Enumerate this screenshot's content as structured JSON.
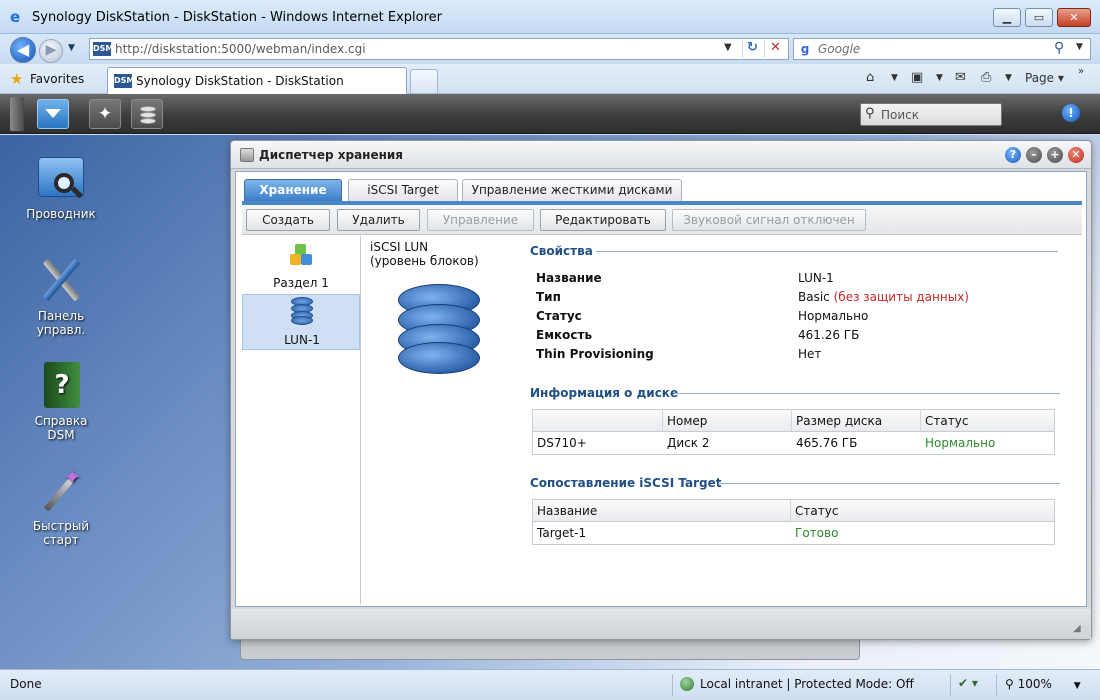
{
  "browser": {
    "window_title": "Synology DiskStation - DiskStation - Windows Internet Explorer",
    "url": "http://diskstation:5000/webman/index.cgi",
    "search_placeholder": "Google",
    "favorites_label": "Favorites",
    "tab_title": "Synology DiskStation - DiskStation",
    "page_menu": "Page",
    "favicon_text": "DSM"
  },
  "dsm_taskbar": {
    "search_placeholder": "Поиск"
  },
  "desktop_icons": [
    {
      "label": "Проводник"
    },
    {
      "label": "Панель управл."
    },
    {
      "label": "Справка DSM"
    },
    {
      "label": "Быстрый старт"
    }
  ],
  "storage_window": {
    "title": "Диспетчер хранения",
    "tabs": [
      "Хранение",
      "iSCSI Target",
      "Управление жесткими дисками"
    ],
    "toolbar": {
      "create": "Создать",
      "delete": "Удалить",
      "manage": "Управление",
      "edit": "Редактировать",
      "beep": "Звуковой сигнал отключен"
    },
    "volumes": [
      {
        "label": "Раздел 1"
      },
      {
        "label": "LUN-1"
      }
    ],
    "lun_header_line1": "iSCSI LUN",
    "lun_header_line2": "(уровень блоков)",
    "properties": {
      "section": "Свойства",
      "rows": [
        {
          "key": "Название",
          "value": "LUN-1"
        },
        {
          "key": "Тип",
          "value": "Basic",
          "note": "(без защиты данных)"
        },
        {
          "key": "Статус",
          "value": "Нормально"
        },
        {
          "key": "Емкость",
          "value": "461.26 ГБ"
        },
        {
          "key": "Thin Provisioning",
          "value": "Нет"
        }
      ]
    },
    "disk_info": {
      "section": "Информация о диске",
      "headers": [
        "",
        "Номер",
        "Размер диска",
        "Статус"
      ],
      "rows": [
        [
          "DS710+",
          "Диск 2",
          "465.76 ГБ",
          "Нормально"
        ]
      ]
    },
    "iscsi_mapping": {
      "section": "Сопоставление iSCSI Target",
      "headers": [
        "Название",
        "Статус"
      ],
      "rows": [
        [
          "Target-1",
          "Готово"
        ]
      ]
    }
  },
  "status_bar": {
    "done": "Done",
    "zone": "Local intranet | Protected Mode: Off",
    "zoom": "100%"
  },
  "colors": {
    "accent_blue": "#3b7fc9",
    "ok_green": "#2c8a2c",
    "warn_red": "#c52a2a"
  }
}
